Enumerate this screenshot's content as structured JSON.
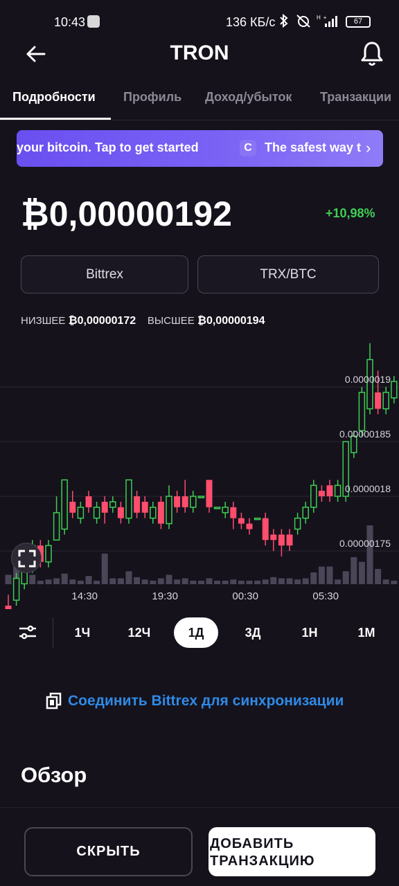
{
  "status_bar": {
    "time": "10:43",
    "network_speed": "136 КБ/с",
    "signal_label": "H+",
    "battery": "67"
  },
  "header": {
    "title": "TRON",
    "back_icon": "arrow-left-icon",
    "bell_icon": "bell-icon"
  },
  "tabs": [
    {
      "label": "Подробности",
      "active": true
    },
    {
      "label": "Профиль",
      "active": false
    },
    {
      "label": "Доход/убыток",
      "active": false
    },
    {
      "label": "Транзакции",
      "active": false
    }
  ],
  "banner": {
    "text_left": "your bitcoin. Tap to get started",
    "logo_letter": "C",
    "text_right": "The safest way t",
    "chevron": "›"
  },
  "price": {
    "value": "₿0,00000192",
    "change": "+10,98%"
  },
  "pills": {
    "exchange": "Bittrex",
    "pair": "TRX/BTC"
  },
  "range": {
    "low_label": "НИЗШЕЕ",
    "low_value": "₿0,00000172",
    "high_label": "ВЫСШЕЕ",
    "high_value": "₿0,00000194"
  },
  "chart_data": {
    "type": "candlestick",
    "y_tick_labels": [
      "0.0000019",
      "0.00000185",
      "0.0000018",
      "0.00000175"
    ],
    "y_ticks": [
      1.9e-06,
      1.85e-06,
      1.8e-06,
      1.75e-06
    ],
    "x_tick_labels": [
      "14:30",
      "19:30",
      "00:30",
      "05:30"
    ],
    "x_ticks": [
      9.5,
      19.5,
      29.5,
      39.5
    ],
    "up_color": "#3ecf52",
    "down_color": "#ff4d6d",
    "volume_color": "#4a4658",
    "candles": [
      {
        "i": 0,
        "o": 1.7,
        "c": 1.69,
        "h": 1.71,
        "l": 1.68,
        "v": 0.8
      },
      {
        "i": 1,
        "o": 1.705,
        "c": 1.725,
        "h": 1.73,
        "l": 1.7,
        "v": 1.5
      },
      {
        "i": 2,
        "o": 1.72,
        "c": 1.74,
        "h": 1.745,
        "l": 1.715,
        "v": 1.2
      },
      {
        "i": 3,
        "o": 1.735,
        "c": 1.755,
        "h": 1.76,
        "l": 1.73,
        "v": 0.8
      },
      {
        "i": 4,
        "o": 1.755,
        "c": 1.74,
        "h": 1.76,
        "l": 1.735,
        "v": 0.3
      },
      {
        "i": 5,
        "o": 1.74,
        "c": 1.755,
        "h": 1.76,
        "l": 1.735,
        "v": 0.4
      },
      {
        "i": 6,
        "o": 1.76,
        "c": 1.785,
        "h": 1.8,
        "l": 1.76,
        "v": 0.5
      },
      {
        "i": 7,
        "o": 1.77,
        "c": 1.815,
        "h": 1.815,
        "l": 1.765,
        "v": 0.9
      },
      {
        "i": 8,
        "o": 1.795,
        "c": 1.785,
        "h": 1.805,
        "l": 1.78,
        "v": 0.4
      },
      {
        "i": 9,
        "o": 1.78,
        "c": 1.79,
        "h": 1.795,
        "l": 1.775,
        "v": 0.3
      },
      {
        "i": 10,
        "o": 1.8,
        "c": 1.79,
        "h": 1.805,
        "l": 1.785,
        "v": 0.7
      },
      {
        "i": 11,
        "o": 1.78,
        "c": 1.79,
        "h": 1.795,
        "l": 1.775,
        "v": 0.3
      },
      {
        "i": 12,
        "o": 1.795,
        "c": 1.785,
        "h": 1.8,
        "l": 1.775,
        "v": 2.6
      },
      {
        "i": 13,
        "o": 1.79,
        "c": 1.795,
        "h": 1.8,
        "l": 1.785,
        "v": 0.5
      },
      {
        "i": 14,
        "o": 1.79,
        "c": 1.78,
        "h": 1.795,
        "l": 1.775,
        "v": 0.5
      },
      {
        "i": 15,
        "o": 1.78,
        "c": 1.815,
        "h": 1.815,
        "l": 1.775,
        "v": 1.1
      },
      {
        "i": 16,
        "o": 1.8,
        "c": 1.785,
        "h": 1.805,
        "l": 1.78,
        "v": 0.6
      },
      {
        "i": 17,
        "o": 1.795,
        "c": 1.785,
        "h": 1.8,
        "l": 1.78,
        "v": 0.4
      },
      {
        "i": 18,
        "o": 1.78,
        "c": 1.79,
        "h": 1.795,
        "l": 1.775,
        "v": 0.3
      },
      {
        "i": 19,
        "o": 1.795,
        "c": 1.775,
        "h": 1.8,
        "l": 1.77,
        "v": 0.5
      },
      {
        "i": 20,
        "o": 1.775,
        "c": 1.8,
        "h": 1.81,
        "l": 1.77,
        "v": 0.8
      },
      {
        "i": 21,
        "o": 1.8,
        "c": 1.79,
        "h": 1.805,
        "l": 1.785,
        "v": 0.4
      },
      {
        "i": 22,
        "o": 1.8,
        "c": 1.79,
        "h": 1.815,
        "l": 1.785,
        "v": 0.5
      },
      {
        "i": 23,
        "o": 1.79,
        "c": 1.8,
        "h": 1.805,
        "l": 1.785,
        "v": 0.3
      },
      {
        "i": 24,
        "o": 1.8,
        "c": 1.8,
        "h": 1.8,
        "l": 1.8,
        "v": 0.3
      },
      {
        "i": 25,
        "o": 1.815,
        "c": 1.79,
        "h": 1.815,
        "l": 1.785,
        "v": 0.5
      },
      {
        "i": 26,
        "o": 1.79,
        "c": 1.79,
        "h": 1.79,
        "l": 1.79,
        "v": 0.3
      },
      {
        "i": 27,
        "o": 1.785,
        "c": 1.79,
        "h": 1.795,
        "l": 1.78,
        "v": 0.3
      },
      {
        "i": 28,
        "o": 1.79,
        "c": 1.78,
        "h": 1.795,
        "l": 1.77,
        "v": 0.4
      },
      {
        "i": 29,
        "o": 1.78,
        "c": 1.775,
        "h": 1.785,
        "l": 1.77,
        "v": 0.3
      },
      {
        "i": 30,
        "o": 1.775,
        "c": 1.77,
        "h": 1.78,
        "l": 1.765,
        "v": 0.3
      },
      {
        "i": 31,
        "o": 1.78,
        "c": 1.78,
        "h": 1.78,
        "l": 1.78,
        "v": 0.3
      },
      {
        "i": 32,
        "o": 1.78,
        "c": 1.76,
        "h": 1.785,
        "l": 1.755,
        "v": 0.4
      },
      {
        "i": 33,
        "o": 1.765,
        "c": 1.76,
        "h": 1.77,
        "l": 1.75,
        "v": 0.6
      },
      {
        "i": 34,
        "o": 1.765,
        "c": 1.755,
        "h": 1.77,
        "l": 1.745,
        "v": 0.5
      },
      {
        "i": 35,
        "o": 1.765,
        "c": 1.755,
        "h": 1.77,
        "l": 1.75,
        "v": 0.5
      },
      {
        "i": 36,
        "o": 1.77,
        "c": 1.78,
        "h": 1.785,
        "l": 1.765,
        "v": 0.4
      },
      {
        "i": 37,
        "o": 1.78,
        "c": 1.79,
        "h": 1.795,
        "l": 1.775,
        "v": 0.5
      },
      {
        "i": 38,
        "o": 1.79,
        "c": 1.81,
        "h": 1.815,
        "l": 1.785,
        "v": 1.0
      },
      {
        "i": 39,
        "o": 1.805,
        "c": 1.8,
        "h": 1.81,
        "l": 1.795,
        "v": 1.5
      },
      {
        "i": 40,
        "o": 1.81,
        "c": 1.8,
        "h": 1.815,
        "l": 1.795,
        "v": 1.5
      },
      {
        "i": 41,
        "o": 1.8,
        "c": 1.81,
        "h": 1.815,
        "l": 1.795,
        "v": 0.4
      },
      {
        "i": 42,
        "o": 1.8,
        "c": 1.85,
        "h": 1.85,
        "l": 1.795,
        "v": 1.1
      },
      {
        "i": 43,
        "o": 1.84,
        "c": 1.855,
        "h": 1.86,
        "l": 1.835,
        "v": 2.3
      },
      {
        "i": 44,
        "o": 1.86,
        "c": 1.895,
        "h": 1.9,
        "l": 1.855,
        "v": 1.9
      },
      {
        "i": 45,
        "o": 1.88,
        "c": 1.925,
        "h": 1.94,
        "l": 1.875,
        "v": 5.0
      },
      {
        "i": 46,
        "o": 1.895,
        "c": 1.88,
        "h": 1.915,
        "l": 1.875,
        "v": 1.3
      },
      {
        "i": 47,
        "o": 1.88,
        "c": 1.895,
        "h": 1.9,
        "l": 1.875,
        "v": 0.4
      },
      {
        "i": 48,
        "o": 1.89,
        "c": 1.905,
        "h": 1.91,
        "l": 1.885,
        "v": 0.3
      },
      {
        "i": 49,
        "o": 1.905,
        "c": 1.89,
        "h": 1.91,
        "l": 1.885,
        "v": 0.3
      }
    ]
  },
  "timeframes": [
    {
      "label": "1Ч",
      "active": false
    },
    {
      "label": "12Ч",
      "active": false
    },
    {
      "label": "1Д",
      "active": true
    },
    {
      "label": "3Д",
      "active": false
    },
    {
      "label": "1Н",
      "active": false
    },
    {
      "label": "1М",
      "active": false
    }
  ],
  "connect_link": "Соединить Bittrex для синхронизации",
  "section_title": "Обзор",
  "buttons": {
    "hide": "СКРЫТЬ",
    "add_line1": "ДОБАВИТЬ",
    "add_line2": "ТРАНЗАКЦИЮ"
  }
}
